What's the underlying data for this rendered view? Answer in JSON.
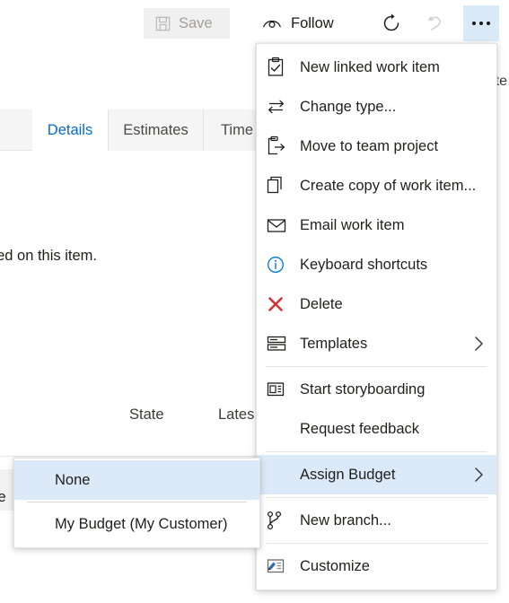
{
  "toolbar": {
    "save_label": "Save",
    "follow_label": "Follow",
    "refresh_icon": "refresh-icon",
    "undo_icon": "undo-icon",
    "more_icon": "ellipsis-icon"
  },
  "background": {
    "updated_text": "Update",
    "tabs": [
      {
        "label": "Details",
        "active": true
      },
      {
        "label": "Estimates",
        "active": false
      },
      {
        "label": "Time",
        "active": false
      }
    ],
    "body_text": "rted on this item.",
    "column_state": "State",
    "column_latest": "Lates",
    "fragment_left": "re"
  },
  "context_menu": {
    "items": [
      {
        "label": "New linked work item",
        "icon": "new-linked-work-item-icon",
        "submenu": false,
        "highlight": false
      },
      {
        "label": "Change type...",
        "icon": "change-type-icon",
        "submenu": false,
        "highlight": false
      },
      {
        "label": "Move to team project",
        "icon": "move-to-team-project-icon",
        "submenu": false,
        "highlight": false
      },
      {
        "label": "Create copy of work item...",
        "icon": "copy-icon",
        "submenu": false,
        "highlight": false
      },
      {
        "label": "Email work item",
        "icon": "mail-icon",
        "submenu": false,
        "highlight": false
      },
      {
        "label": "Keyboard shortcuts",
        "icon": "info-icon",
        "submenu": false,
        "highlight": false
      },
      {
        "label": "Delete",
        "icon": "delete-x-icon",
        "submenu": false,
        "highlight": false
      },
      {
        "label": "Templates",
        "icon": "templates-icon",
        "submenu": true,
        "highlight": false
      },
      {
        "label": "Start storyboarding",
        "icon": "storyboard-icon",
        "submenu": false,
        "highlight": false
      },
      {
        "label": "Request feedback",
        "icon": "none",
        "submenu": false,
        "highlight": false
      },
      {
        "label": "Assign Budget",
        "icon": "none",
        "submenu": true,
        "highlight": true
      },
      {
        "label": "New branch...",
        "icon": "branch-icon",
        "submenu": false,
        "highlight": false
      },
      {
        "label": "Customize",
        "icon": "customize-icon",
        "submenu": false,
        "highlight": false
      }
    ]
  },
  "submenu": {
    "items": [
      {
        "label": "None",
        "highlight": true
      },
      {
        "label": "My Budget (My Customer)",
        "highlight": false
      }
    ]
  },
  "colors": {
    "highlight": "#dbe9f8",
    "accent_blue": "#0a69c8",
    "delete_red": "#d13438",
    "info_blue": "#0078d4",
    "text": "#201f1e",
    "disabled": "#a19f9d"
  }
}
